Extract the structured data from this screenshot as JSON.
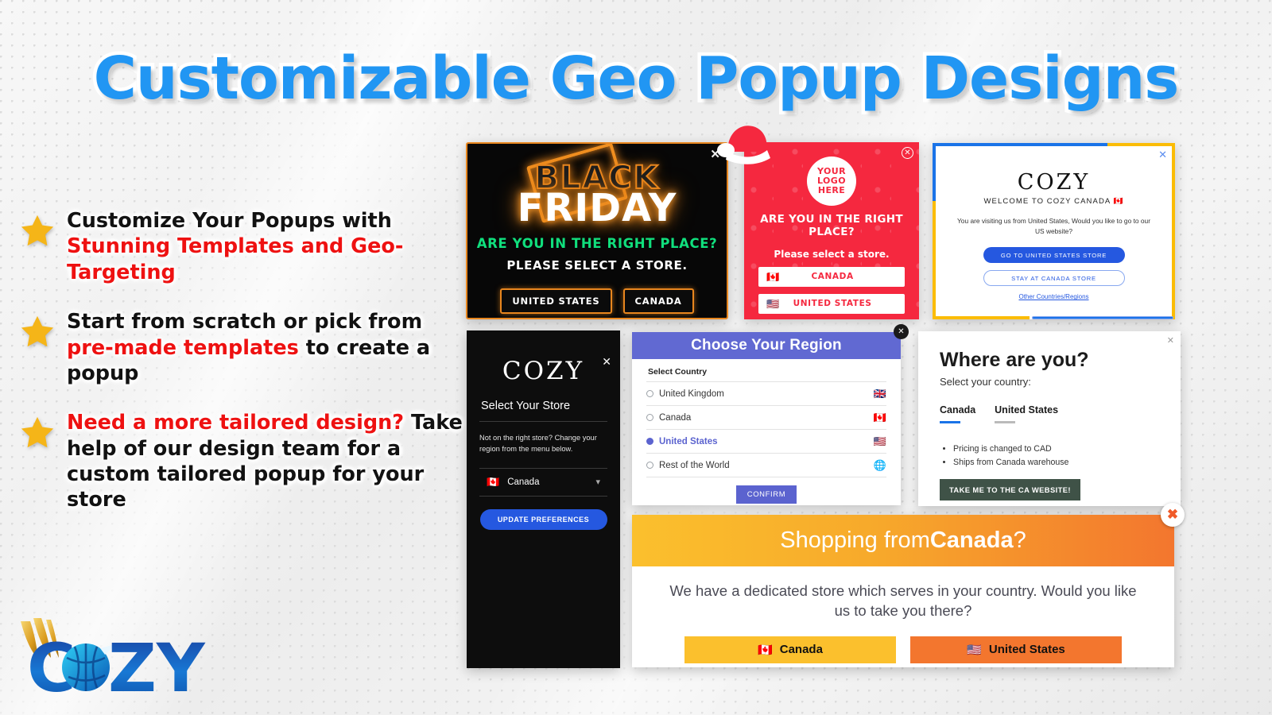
{
  "title": "Customizable Geo Popup Designs",
  "brand": {
    "logo_text": "COZY"
  },
  "bullets": [
    {
      "pre": "Customize Your Popups with ",
      "hl": "Stunning Templates and Geo-Targeting",
      "post": ""
    },
    {
      "pre": "Start from scratch or pick from ",
      "hl": "pre-made templates",
      "post": " to create a popup"
    },
    {
      "pre": "",
      "hl": "Need a more tailored design?",
      "post": " Take help of our design team for a custom tailored popup for your store"
    }
  ],
  "black_friday": {
    "close": "✕",
    "word_black": "BLACK",
    "word_friday": "FRIDAY",
    "question": "ARE YOU IN THE RIGHT PLACE?",
    "subtitle": "PLEASE SELECT A STORE.",
    "btn_us": "UNITED STATES",
    "btn_ca": "CANADA",
    "accent": "#e8861e",
    "question_color": "#10e07e"
  },
  "red_popup": {
    "close": "✕",
    "logo_line1": "YOUR",
    "logo_line2": "LOGO",
    "logo_line3": "HERE",
    "question": "ARE YOU IN THE RIGHT PLACE?",
    "subtitle": "Please select a store.",
    "btn_ca": "CANADA",
    "btn_us": "UNITED STATES",
    "flag_ca": "🇨🇦",
    "flag_us": "🇺🇸",
    "bg_color": "#f5283f"
  },
  "cozy_canada": {
    "close": "✕",
    "brand": "COZY",
    "welcome": "WELCOME TO COZY CANADA 🇨🇦",
    "message": "You are visiting us from United States, Would you like to go to our US website?",
    "btn_primary": "GO TO UNITED STATES STORE",
    "btn_secondary": "STAY AT CANADA STORE",
    "link": "Other Countries/Regions",
    "border_blue": "#1a73e8",
    "border_yellow": "#fbbc05"
  },
  "cozy_dark": {
    "close": "✕",
    "brand": "COZY",
    "heading": "Select Your Store",
    "note": "Not on the right store? Change your region from the menu below.",
    "dropdown_value": "Canada",
    "dropdown_flag": "🇨🇦",
    "dropdown_caret": "▾",
    "button": "UPDATE PREFERENCES",
    "accent": "#2558e0"
  },
  "choose_region": {
    "close": "✕",
    "header": "Choose Your Region",
    "label": "Select Country",
    "options": [
      {
        "label": "United Kingdom",
        "flag": "🇬🇧",
        "selected": false
      },
      {
        "label": "Canada",
        "flag": "🇨🇦",
        "selected": false
      },
      {
        "label": "United States",
        "flag": "🇺🇸",
        "selected": true
      },
      {
        "label": "Rest of the World",
        "flag": "🌐",
        "selected": false
      }
    ],
    "confirm": "CONFIRM",
    "accent": "#6169d2"
  },
  "where_are_you": {
    "close": "✕",
    "title": "Where are you?",
    "subtitle": "Select your country:",
    "tabs": [
      {
        "label": "Canada",
        "active": true
      },
      {
        "label": "United States",
        "active": false
      }
    ],
    "bullets": [
      "Pricing is changed to CAD",
      "Ships from Canada warehouse"
    ],
    "cta": "TAKE ME TO THE CA WEBSITE!",
    "cta_color": "#3f5247"
  },
  "shopping_banner": {
    "close": "✖",
    "head_prefix": "Shopping from ",
    "head_country": "Canada",
    "head_suffix": "?",
    "message": "We have a dedicated store which serves in your country. Would you like us to take you there?",
    "btn_ca": "Canada",
    "btn_us": "United States",
    "flag_ca": "🇨🇦",
    "flag_us": "🇺🇸",
    "gradient_from": "#fbc02d",
    "gradient_to": "#f3762e"
  }
}
